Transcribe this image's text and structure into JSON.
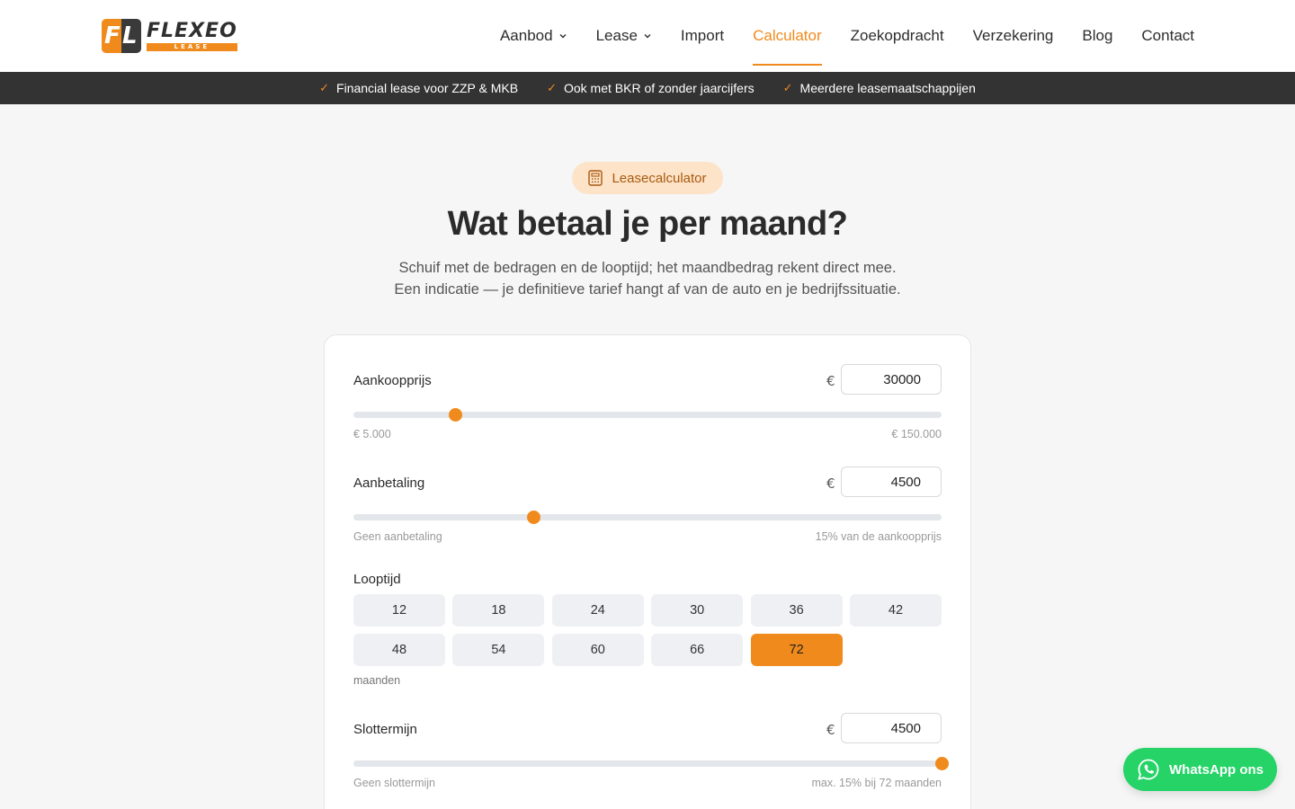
{
  "brand": {
    "name": "FLEXEO",
    "sub": "LEASE",
    "mark_left": "F",
    "mark_right": "L",
    "accent": "#f18a1c"
  },
  "nav": {
    "items": [
      {
        "label": "Aanbod",
        "dropdown": true
      },
      {
        "label": "Lease",
        "dropdown": true
      },
      {
        "label": "Import",
        "dropdown": false
      },
      {
        "label": "Calculator",
        "dropdown": false,
        "active": true
      },
      {
        "label": "Zoekopdracht",
        "dropdown": false
      },
      {
        "label": "Verzekering",
        "dropdown": false
      },
      {
        "label": "Blog",
        "dropdown": false
      },
      {
        "label": "Contact",
        "dropdown": false
      }
    ]
  },
  "usps": [
    "Financial lease voor ZZP & MKB",
    "Ook met BKR of zonder jaarcijfers",
    "Meerdere leasemaatschappijen"
  ],
  "hero": {
    "badge": "Leasecalculator",
    "title": "Wat betaal je per maand?",
    "subtitle_line1": "Schuif met de bedragen en de looptijd; het maandbedrag rekent direct mee.",
    "subtitle_line2": "Een indicatie — je definitieve tarief hangt af van de auto en je bedrijfssituatie."
  },
  "calculator": {
    "currency": "€",
    "purchase": {
      "label": "Aankoopprijs",
      "value": "30000",
      "min_label": "€ 5.000",
      "max_label": "€ 150.000",
      "level": 0.1724
    },
    "downpayment": {
      "label": "Aanbetaling",
      "value": "4500",
      "min_label": "Geen aanbetaling",
      "max_label": "15% van de aankoopprijs",
      "level": 0.306
    },
    "term": {
      "label": "Looptijd",
      "options": [
        "12",
        "18",
        "24",
        "30",
        "36",
        "42",
        "48",
        "54",
        "60",
        "66",
        "72"
      ],
      "selected": "72",
      "unit": "maanden"
    },
    "balloon": {
      "label": "Slottermijn",
      "value": "4500",
      "min_label": "Geen slottermijn",
      "max_label": "max. 15% bij 72 maanden",
      "level": 1.0
    }
  },
  "whatsapp": {
    "label": "WhatsApp ons",
    "color": "#25d366"
  }
}
